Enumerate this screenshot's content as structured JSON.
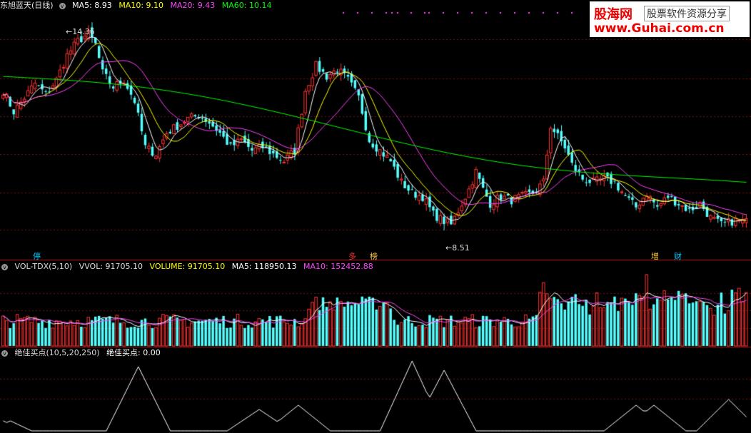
{
  "main_header": {
    "title": "东旭蓝天(日线)",
    "ma5": "MA5: 8.93",
    "ma10": "MA10: 9.10",
    "ma20": "MA20: 9.43",
    "ma60": "MA60: 10.14",
    "colors": {
      "title": "#e6e6e6",
      "ma5": "#ffffff",
      "ma10": "#ffff00",
      "ma20": "#ff44ff",
      "ma60": "#00ff00"
    }
  },
  "vol_header": {
    "name": "VOL-TDX(5,10)",
    "vvol": "VVOL: 91705.10",
    "volume": "VOLUME: 91705.10",
    "ma5": "MA5: 118950.13",
    "ma10": "MA10: 152452.88"
  },
  "ind_header": {
    "name": "绝佳买点(10,5,20,250)",
    "value": "绝佳买点: 0.00"
  },
  "watermark": {
    "brand": "股海网",
    "slogan": "股票软件资源分享",
    "url": "www.Guhai.com.cn"
  },
  "annotations": {
    "high_label": "14.36",
    "low_label": "8.51"
  },
  "tags": [
    {
      "text": "停",
      "color": "#00ccff"
    },
    {
      "text": "多",
      "color": "#ff3333"
    },
    {
      "text": "榜",
      "color": "#ffcc44"
    },
    {
      "text": "增",
      "color": "#ffcc44"
    },
    {
      "text": "财",
      "color": "#00ccff"
    }
  ],
  "chart_data": {
    "type": "candlestick",
    "price_axis_ref": {
      "top_price": 14.8,
      "bottom_price": 8.3
    },
    "high": 14.36,
    "low": 8.51,
    "close_points": [
      [
        0,
        12.6
      ],
      [
        3,
        12.0
      ],
      [
        6,
        12.4
      ],
      [
        9,
        12.8
      ],
      [
        12,
        12.5
      ],
      [
        15,
        12.9
      ],
      [
        18,
        13.6
      ],
      [
        21,
        14.0
      ],
      [
        24,
        14.2
      ],
      [
        26,
        13.9
      ],
      [
        28,
        13.1
      ],
      [
        31,
        12.7
      ],
      [
        34,
        12.9
      ],
      [
        37,
        12.3
      ],
      [
        40,
        11.0
      ],
      [
        43,
        10.8
      ],
      [
        46,
        11.4
      ],
      [
        49,
        11.6
      ],
      [
        52,
        11.8
      ],
      [
        55,
        11.9
      ],
      [
        58,
        11.7
      ],
      [
        61,
        11.4
      ],
      [
        64,
        11.0
      ],
      [
        67,
        11.2
      ],
      [
        70,
        10.9
      ],
      [
        73,
        11.0
      ],
      [
        76,
        10.8
      ],
      [
        79,
        10.6
      ],
      [
        82,
        10.9
      ],
      [
        85,
        12.6
      ],
      [
        88,
        13.3
      ],
      [
        91,
        13.0
      ],
      [
        94,
        13.2
      ],
      [
        97,
        12.9
      ],
      [
        100,
        12.4
      ],
      [
        103,
        11.2
      ],
      [
        106,
        10.9
      ],
      [
        109,
        10.6
      ],
      [
        112,
        10.0
      ],
      [
        115,
        9.7
      ],
      [
        118,
        9.6
      ],
      [
        121,
        9.1
      ],
      [
        124,
        8.9
      ],
      [
        126,
        8.8
      ],
      [
        128,
        9.2
      ],
      [
        131,
        9.8
      ],
      [
        133,
        10.3
      ],
      [
        135,
        9.8
      ],
      [
        137,
        9.4
      ],
      [
        140,
        9.6
      ],
      [
        143,
        9.5
      ],
      [
        146,
        9.6
      ],
      [
        149,
        9.7
      ],
      [
        152,
        10.0
      ],
      [
        154,
        11.6
      ],
      [
        156,
        11.3
      ],
      [
        158,
        11.0
      ],
      [
        160,
        10.5
      ],
      [
        163,
        10.1
      ],
      [
        166,
        10.0
      ],
      [
        169,
        10.1
      ],
      [
        172,
        10.0
      ],
      [
        175,
        9.6
      ],
      [
        178,
        9.3
      ],
      [
        181,
        9.7
      ],
      [
        184,
        9.3
      ],
      [
        187,
        9.6
      ],
      [
        190,
        9.4
      ],
      [
        193,
        9.2
      ],
      [
        196,
        9.4
      ],
      [
        199,
        9.0
      ],
      [
        202,
        8.8
      ],
      [
        206,
        8.93
      ]
    ],
    "ma5": "#ffffff",
    "ma10": "#ffff00",
    "ma20": "#ff44ff",
    "ma60": "#00ff00",
    "up_color": "#ff3333",
    "down_color": "#54ffff",
    "volume_ma5": 118950.13,
    "volume_ma10": 152452.88,
    "volume_last": 91705.1,
    "indicator_last": 0.0,
    "indicator_peaks": [
      [
        0,
        2
      ],
      [
        2,
        2
      ],
      [
        38,
        3
      ],
      [
        72,
        3
      ],
      [
        83,
        3
      ],
      [
        115,
        3
      ],
      [
        124,
        3
      ],
      [
        178,
        3
      ],
      [
        183,
        3
      ],
      [
        204,
        3
      ]
    ]
  }
}
